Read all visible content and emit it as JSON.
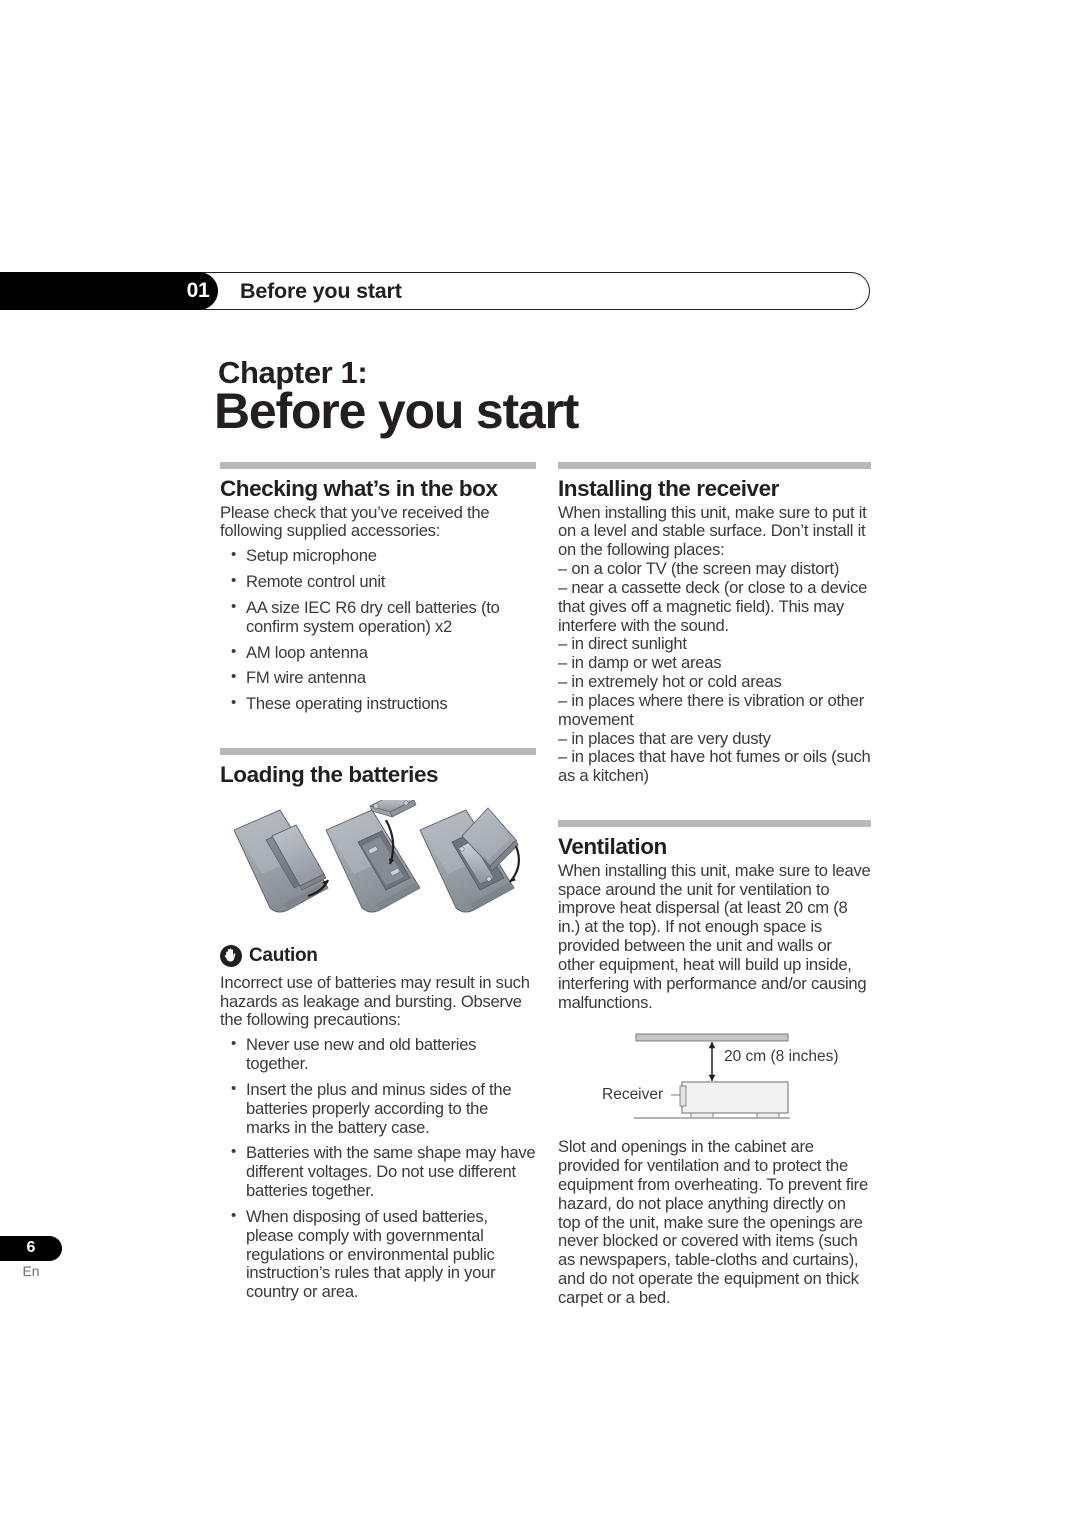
{
  "header": {
    "chapter_number": "01",
    "running_title": "Before you start"
  },
  "chapter": {
    "label": "Chapter 1:",
    "title": "Before you start"
  },
  "left_column": {
    "section_checking": {
      "heading": "Checking what’s in the box",
      "intro": "Please check that you’ve received the following supplied accessories:",
      "items": [
        "Setup microphone",
        "Remote control unit",
        "AA size IEC R6 dry cell batteries (to confirm system operation) x2",
        "AM loop antenna",
        "FM wire antenna",
        "These operating instructions"
      ]
    },
    "section_batteries": {
      "heading": "Loading the batteries",
      "figure_alt": "remote-control-battery-loading-illustration",
      "caution_label": "Caution",
      "caution_icon": "hand-stop-icon",
      "caution_intro": "Incorrect use of batteries may result in such hazards as leakage and bursting. Observe the following precautions:",
      "caution_items": [
        "Never use new and old batteries together.",
        "Insert the plus and minus sides of the batteries properly according to the marks in the battery case.",
        "Batteries with the same shape may have different voltages. Do not use different batteries together.",
        "When disposing of used batteries, please comply with governmental regulations or environmental public instruction’s rules that apply in your country or area."
      ]
    }
  },
  "right_column": {
    "section_installing": {
      "heading": "Installing the receiver",
      "intro": "When installing this unit, make sure to put it on a level and stable surface. Don’t install it on the following places:",
      "places": [
        "– on a color TV (the screen may distort)",
        "– near a cassette deck (or close to a device that gives off a magnetic field). This may interfere with the sound.",
        "– in direct sunlight",
        "– in damp or wet areas",
        "– in extremely hot or cold areas",
        "– in places where there is vibration or other movement",
        "– in places that are very dusty",
        "– in places that have hot fumes or oils (such as a kitchen)"
      ]
    },
    "section_ventilation": {
      "heading": "Ventilation",
      "intro": "When installing this unit, make sure to leave space around the unit for ventilation to improve heat dispersal (at least 20 cm (8 in.) at the top). If not enough space is provided between the unit and walls or other equipment, heat will build up inside, interfering with performance and/or causing malfunctions.",
      "diagram": {
        "clearance_label": "20 cm (8 inches)",
        "device_label": "Receiver"
      },
      "outro": "Slot and openings in the cabinet are provided for ventilation and to protect the equipment from overheating. To prevent fire hazard, do not place anything directly on top of the unit, make sure the openings are never blocked or covered with items (such as newspapers, table-cloths and curtains), and do not operate the equipment on thick carpet or a bed."
    }
  },
  "footer": {
    "page_number": "6",
    "language": "En"
  },
  "colors": {
    "ink": "#231f20",
    "body_text": "#3a3a3c",
    "rule": "#b6b8ba",
    "remote_body": "#9aa0a8"
  }
}
